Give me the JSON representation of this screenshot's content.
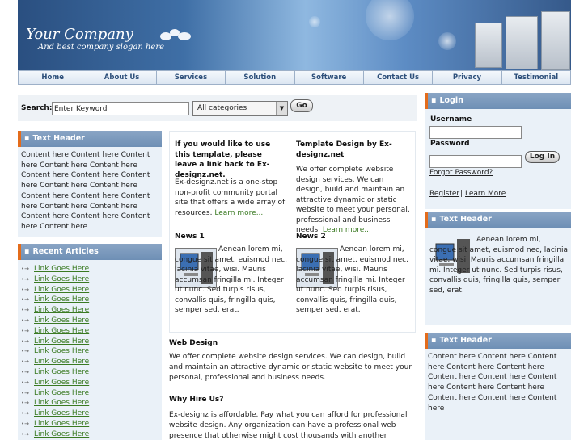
{
  "header": {
    "company": "Your Company",
    "slogan": "And best company slogan here"
  },
  "nav": [
    "Home",
    "About Us",
    "Services",
    "Solution",
    "Software",
    "Contact Us",
    "Privacy",
    "Testimonial"
  ],
  "search": {
    "label": "Search:",
    "keyword_value": "Enter Keyword",
    "category": "All categories",
    "go_label": "Go"
  },
  "left": {
    "text_header": "Text Header",
    "text_body": "Content here Content here Content here Content here Content here Content here Content here Content here Content here Content here Content here Content here Content here Content here Content here Content here Content here Content here Content here",
    "recent_header": "Recent Articles",
    "links": [
      "Link Goes Here",
      "Link Goes Here",
      "Link Goes Here",
      "Link Goes Here",
      "Link Goes Here",
      "Link Goes Here",
      "Link Goes Here",
      "Link Goes Here",
      "Link Goes Here",
      "Link Goes Here",
      "Link Goes Here",
      "Link Goes Here",
      "Link Goes Here",
      "Link Goes Here",
      "Link Goes Here",
      "Link Goes Here",
      "Link Goes Here"
    ]
  },
  "main": {
    "col1_heading": "If you would like to use this template, please leave a link back to Ex-designz.net.",
    "col1_text": "Ex-designz.net is a one-stop non-profit community portal site that offers a wide array of resources.",
    "col2_heading": "Template Design by Ex-designz.net",
    "col2_text": "We offer complete website design services. We can design, build and maintain an attractive dynamic or static website to meet your personal, professional and business needs.",
    "learn_more": "Learn more...",
    "news1_title": "News 1",
    "news2_title": "News 2",
    "news_text": "Aenean lorem mi, congue sit amet, euismod nec, lacinia vitae, wisi. Mauris accumsan fringilla mi. Integer ut nunc. Sed turpis risus, convallis quis, fringilla quis, semper sed, erat.",
    "web_design_title": "Web Design",
    "web_design_text": "We offer complete website design services. We can design, build and maintain an attractive dynamic or static website to meet your personal, professional and business needs.",
    "why_title": "Why Hire Us?",
    "why_text": "Ex-designz is affordable. Pay what you can afford for professional website design. Any organization can have a professional web presence that otherwise might cost thousands with another website development"
  },
  "right": {
    "login_header": "Login",
    "username_label": "Username",
    "password_label": "Password",
    "login_button": "Log In",
    "forgot": "Forgot Password?",
    "register": "Register",
    "sep": "|",
    "learn_more": "Learn More",
    "text_header_1": "Text Header",
    "text1": "Aenean lorem mi, congue sit amet, euismod nec, lacinia vitae, wisi. Mauris accumsan fringilla mi. Integer ut nunc. Sed turpis risus, convallis quis, fringilla quis, semper sed, erat.",
    "text_header_2": "Text Header",
    "text2": "Content here Content here Content here Content here Content here Content here Content here Content here Content here Content here Content here Content here Content here"
  },
  "colors": {
    "accent": "#e46c1b",
    "box_header": "#7b9abd",
    "link": "#3a7a22",
    "panel_bg": "#eaf1f8"
  },
  "icons": [
    "server-icon",
    "computer-icon",
    "bullet-arrow-icon",
    "dropdown-arrow-icon"
  ]
}
